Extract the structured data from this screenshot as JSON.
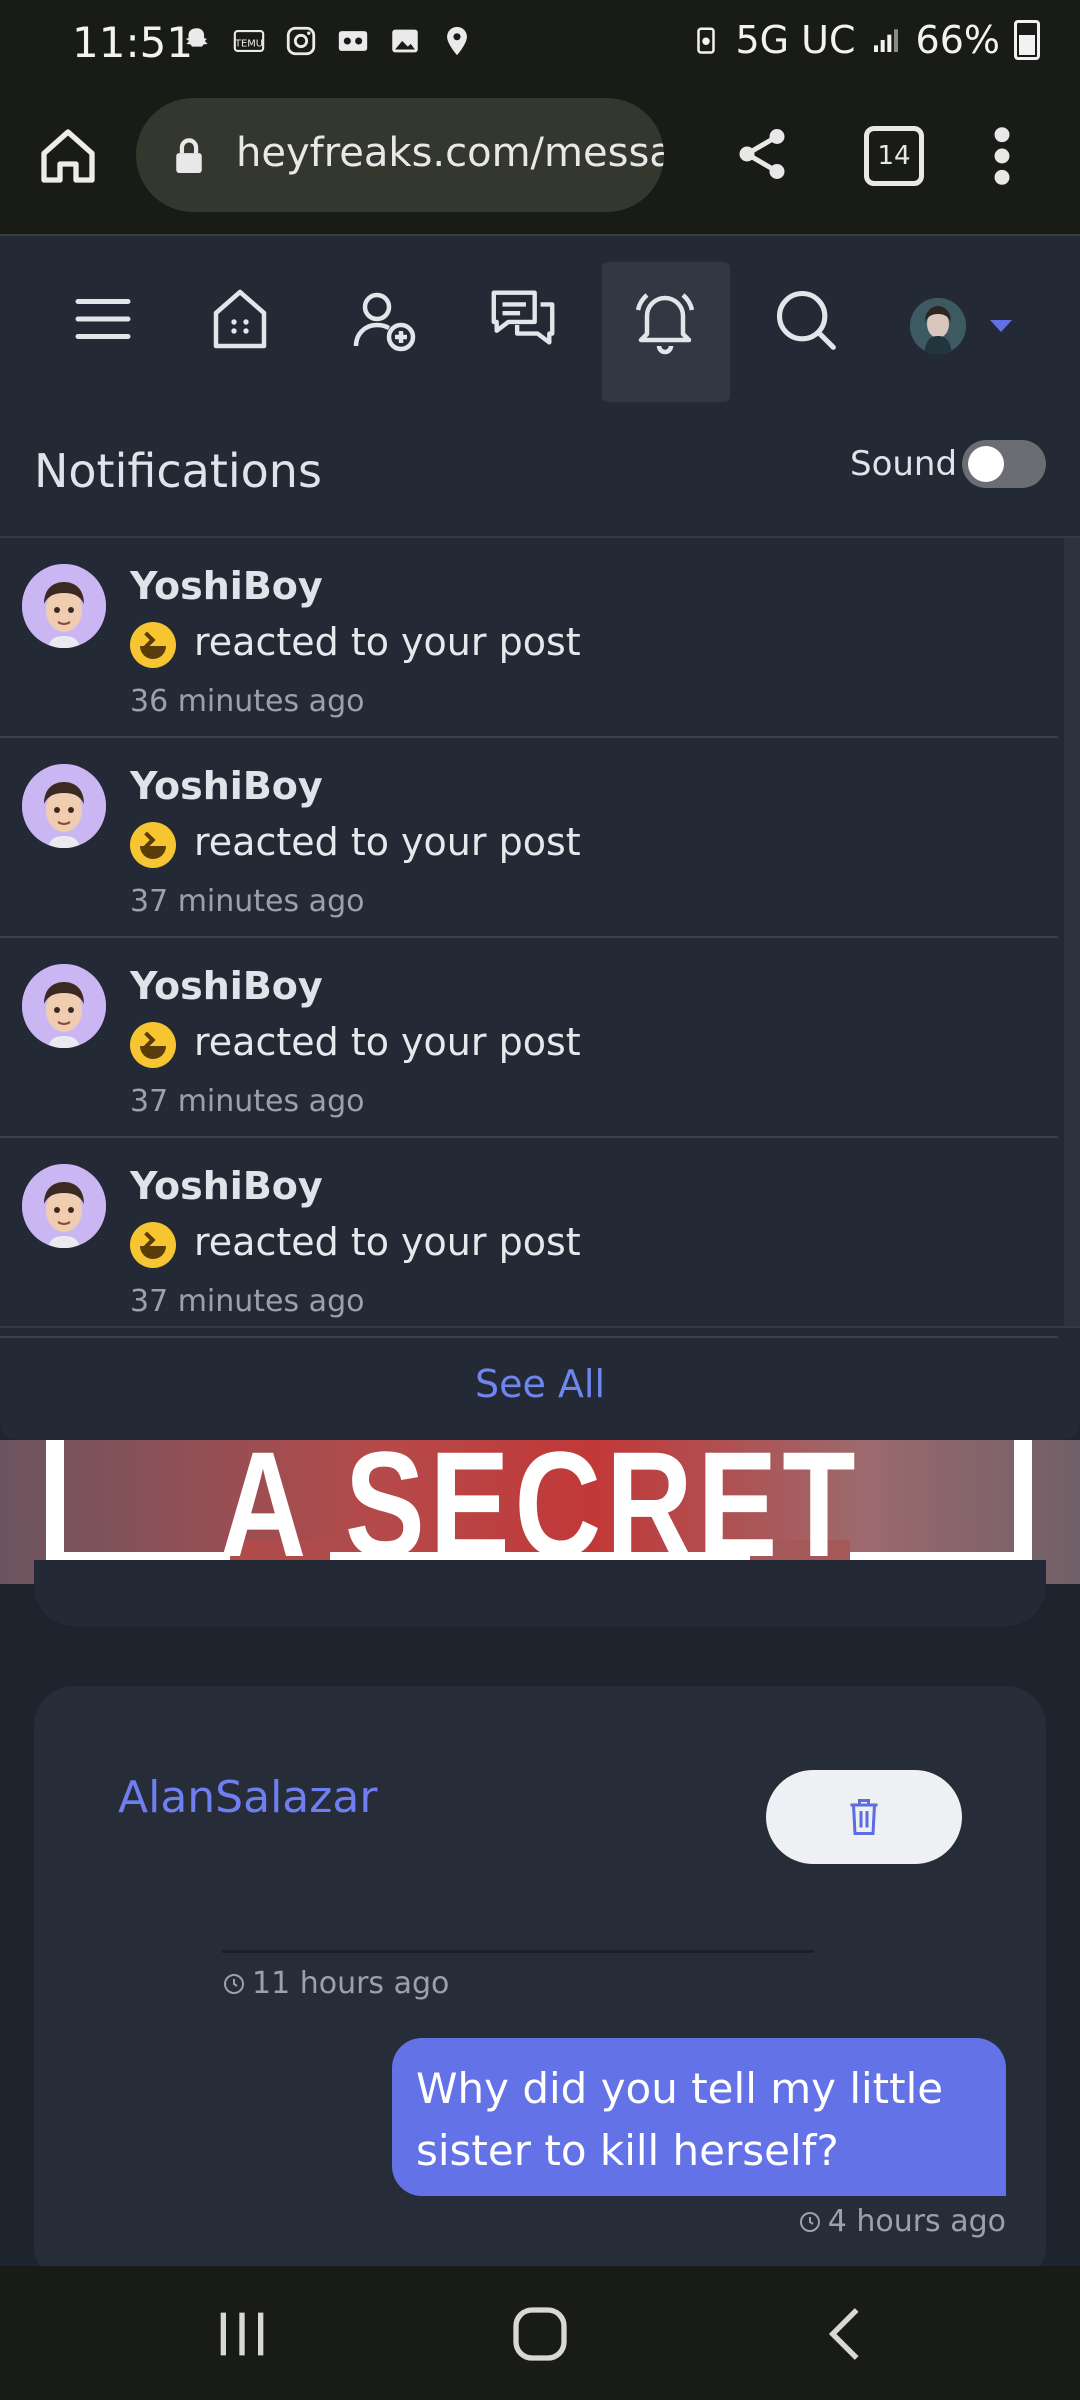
{
  "status_bar": {
    "time": "11:51",
    "left_icons": [
      "snapchat-icon",
      "temu-icon",
      "instagram-icon",
      "voicemail-icon",
      "gallery-icon",
      "location-icon"
    ],
    "network": "5G UC",
    "battery": "66%"
  },
  "browser": {
    "url": "heyfreaks.com/messag",
    "tab_count": "14"
  },
  "site_nav": {
    "icons": [
      "menu-icon",
      "home-icon",
      "add-friend-icon",
      "messages-icon",
      "notifications-icon",
      "search-icon",
      "avatar"
    ],
    "active": "notifications-icon"
  },
  "notifications": {
    "title": "Notifications",
    "sound_label": "Sound",
    "sound_on": false,
    "items": [
      {
        "user": "YoshiBoy",
        "text": "reacted to your post",
        "time": "36 minutes ago"
      },
      {
        "user": "YoshiBoy",
        "text": "reacted to your post",
        "time": "37 minutes ago"
      },
      {
        "user": "YoshiBoy",
        "text": "reacted to your post",
        "time": "37 minutes ago"
      },
      {
        "user": "YoshiBoy",
        "text": "reacted to your post",
        "time": "37 minutes ago"
      }
    ],
    "see_all": "See All"
  },
  "hero": {
    "text": "A SECRET"
  },
  "message": {
    "username": "AlanSalazar",
    "time_top": "11 hours ago",
    "bubble": "Why did you tell my little sister to kill herself?",
    "time_bottom": "4 hours ago"
  },
  "colors": {
    "accent": "#6372e6",
    "link": "#6f7ef0",
    "panel": "#232a35"
  }
}
